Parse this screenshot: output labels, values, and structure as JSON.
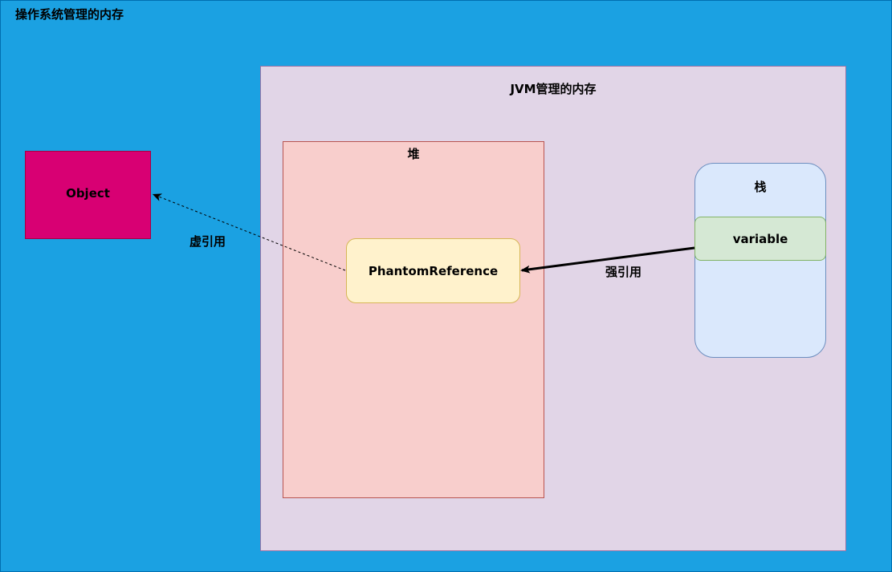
{
  "os_memory": {
    "title": "操作系统管理的内存"
  },
  "jvm_memory": {
    "title": "JVM管理的内存"
  },
  "heap": {
    "title": "堆"
  },
  "stack": {
    "title": "栈",
    "variable_label": "variable"
  },
  "phantom_reference": {
    "label": "PhantomReference"
  },
  "object": {
    "label": "Object"
  },
  "edges": {
    "phantom_label": "虚引用",
    "strong_label": "强引用"
  },
  "colors": {
    "os_fill": "#1ba1e2",
    "jvm_fill": "#e1d5e7",
    "heap_fill": "#f8cecc",
    "stack_fill": "#dae8fc",
    "variable_fill": "#d5e8d4",
    "phantom_fill": "#fff2cc",
    "object_fill": "#d80073"
  }
}
